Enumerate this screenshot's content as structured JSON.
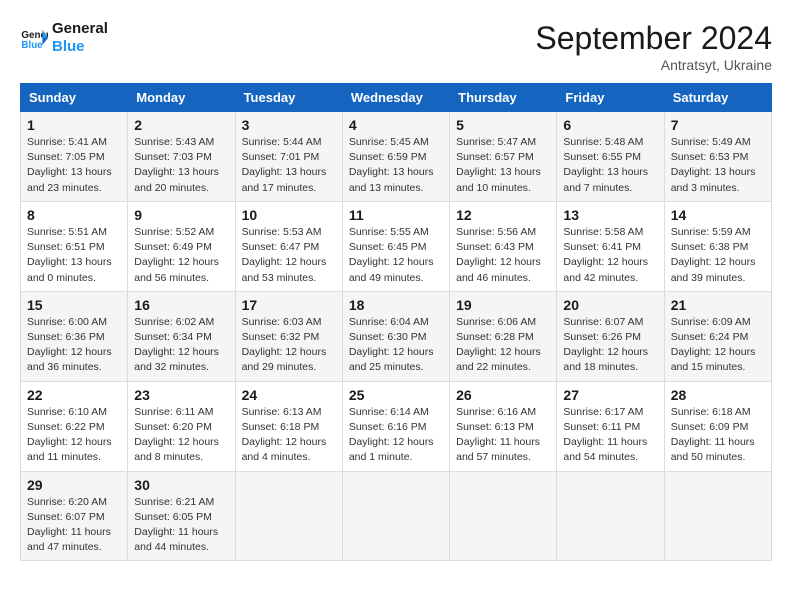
{
  "header": {
    "logo_line1": "General",
    "logo_line2": "Blue",
    "month": "September 2024",
    "location": "Antratsyt, Ukraine"
  },
  "weekdays": [
    "Sunday",
    "Monday",
    "Tuesday",
    "Wednesday",
    "Thursday",
    "Friday",
    "Saturday"
  ],
  "weeks": [
    [
      {
        "day": "1",
        "info": "Sunrise: 5:41 AM\nSunset: 7:05 PM\nDaylight: 13 hours\nand 23 minutes."
      },
      {
        "day": "2",
        "info": "Sunrise: 5:43 AM\nSunset: 7:03 PM\nDaylight: 13 hours\nand 20 minutes."
      },
      {
        "day": "3",
        "info": "Sunrise: 5:44 AM\nSunset: 7:01 PM\nDaylight: 13 hours\nand 17 minutes."
      },
      {
        "day": "4",
        "info": "Sunrise: 5:45 AM\nSunset: 6:59 PM\nDaylight: 13 hours\nand 13 minutes."
      },
      {
        "day": "5",
        "info": "Sunrise: 5:47 AM\nSunset: 6:57 PM\nDaylight: 13 hours\nand 10 minutes."
      },
      {
        "day": "6",
        "info": "Sunrise: 5:48 AM\nSunset: 6:55 PM\nDaylight: 13 hours\nand 7 minutes."
      },
      {
        "day": "7",
        "info": "Sunrise: 5:49 AM\nSunset: 6:53 PM\nDaylight: 13 hours\nand 3 minutes."
      }
    ],
    [
      {
        "day": "8",
        "info": "Sunrise: 5:51 AM\nSunset: 6:51 PM\nDaylight: 13 hours\nand 0 minutes."
      },
      {
        "day": "9",
        "info": "Sunrise: 5:52 AM\nSunset: 6:49 PM\nDaylight: 12 hours\nand 56 minutes."
      },
      {
        "day": "10",
        "info": "Sunrise: 5:53 AM\nSunset: 6:47 PM\nDaylight: 12 hours\nand 53 minutes."
      },
      {
        "day": "11",
        "info": "Sunrise: 5:55 AM\nSunset: 6:45 PM\nDaylight: 12 hours\nand 49 minutes."
      },
      {
        "day": "12",
        "info": "Sunrise: 5:56 AM\nSunset: 6:43 PM\nDaylight: 12 hours\nand 46 minutes."
      },
      {
        "day": "13",
        "info": "Sunrise: 5:58 AM\nSunset: 6:41 PM\nDaylight: 12 hours\nand 42 minutes."
      },
      {
        "day": "14",
        "info": "Sunrise: 5:59 AM\nSunset: 6:38 PM\nDaylight: 12 hours\nand 39 minutes."
      }
    ],
    [
      {
        "day": "15",
        "info": "Sunrise: 6:00 AM\nSunset: 6:36 PM\nDaylight: 12 hours\nand 36 minutes."
      },
      {
        "day": "16",
        "info": "Sunrise: 6:02 AM\nSunset: 6:34 PM\nDaylight: 12 hours\nand 32 minutes."
      },
      {
        "day": "17",
        "info": "Sunrise: 6:03 AM\nSunset: 6:32 PM\nDaylight: 12 hours\nand 29 minutes."
      },
      {
        "day": "18",
        "info": "Sunrise: 6:04 AM\nSunset: 6:30 PM\nDaylight: 12 hours\nand 25 minutes."
      },
      {
        "day": "19",
        "info": "Sunrise: 6:06 AM\nSunset: 6:28 PM\nDaylight: 12 hours\nand 22 minutes."
      },
      {
        "day": "20",
        "info": "Sunrise: 6:07 AM\nSunset: 6:26 PM\nDaylight: 12 hours\nand 18 minutes."
      },
      {
        "day": "21",
        "info": "Sunrise: 6:09 AM\nSunset: 6:24 PM\nDaylight: 12 hours\nand 15 minutes."
      }
    ],
    [
      {
        "day": "22",
        "info": "Sunrise: 6:10 AM\nSunset: 6:22 PM\nDaylight: 12 hours\nand 11 minutes."
      },
      {
        "day": "23",
        "info": "Sunrise: 6:11 AM\nSunset: 6:20 PM\nDaylight: 12 hours\nand 8 minutes."
      },
      {
        "day": "24",
        "info": "Sunrise: 6:13 AM\nSunset: 6:18 PM\nDaylight: 12 hours\nand 4 minutes."
      },
      {
        "day": "25",
        "info": "Sunrise: 6:14 AM\nSunset: 6:16 PM\nDaylight: 12 hours\nand 1 minute."
      },
      {
        "day": "26",
        "info": "Sunrise: 6:16 AM\nSunset: 6:13 PM\nDaylight: 11 hours\nand 57 minutes."
      },
      {
        "day": "27",
        "info": "Sunrise: 6:17 AM\nSunset: 6:11 PM\nDaylight: 11 hours\nand 54 minutes."
      },
      {
        "day": "28",
        "info": "Sunrise: 6:18 AM\nSunset: 6:09 PM\nDaylight: 11 hours\nand 50 minutes."
      }
    ],
    [
      {
        "day": "29",
        "info": "Sunrise: 6:20 AM\nSunset: 6:07 PM\nDaylight: 11 hours\nand 47 minutes."
      },
      {
        "day": "30",
        "info": "Sunrise: 6:21 AM\nSunset: 6:05 PM\nDaylight: 11 hours\nand 44 minutes."
      },
      {
        "day": "",
        "info": ""
      },
      {
        "day": "",
        "info": ""
      },
      {
        "day": "",
        "info": ""
      },
      {
        "day": "",
        "info": ""
      },
      {
        "day": "",
        "info": ""
      }
    ]
  ]
}
